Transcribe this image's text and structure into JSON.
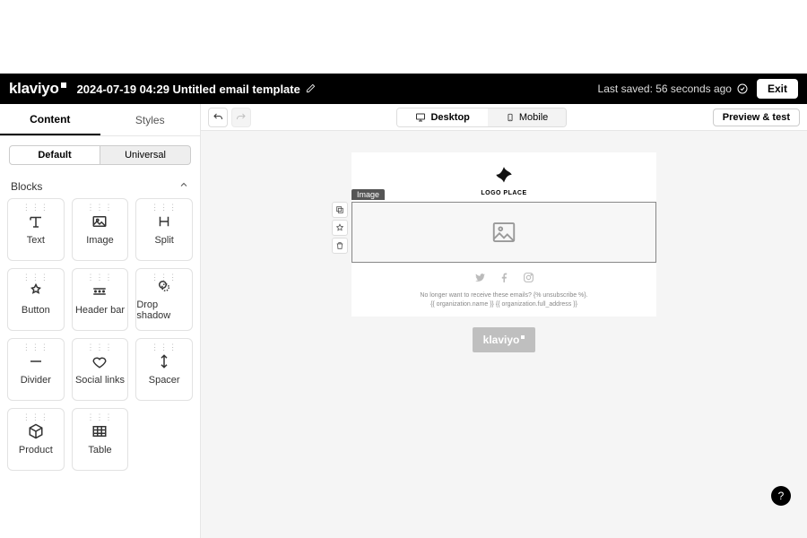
{
  "header": {
    "brand": "klaviyo",
    "title": "2024-07-19 04:29 Untitled email template",
    "last_saved": "Last saved: 56 seconds ago",
    "exit": "Exit"
  },
  "sidebar": {
    "tabs": {
      "content": "Content",
      "styles": "Styles"
    },
    "subtabs": {
      "default": "Default",
      "universal": "Universal"
    },
    "blocks_label": "Blocks",
    "blocks": [
      {
        "id": "text",
        "label": "Text"
      },
      {
        "id": "image",
        "label": "Image"
      },
      {
        "id": "split",
        "label": "Split"
      },
      {
        "id": "button",
        "label": "Button"
      },
      {
        "id": "header-bar",
        "label": "Header bar"
      },
      {
        "id": "drop-shadow",
        "label": "Drop shadow"
      },
      {
        "id": "divider",
        "label": "Divider"
      },
      {
        "id": "social-links",
        "label": "Social links"
      },
      {
        "id": "spacer",
        "label": "Spacer"
      },
      {
        "id": "product",
        "label": "Product"
      },
      {
        "id": "table",
        "label": "Table"
      }
    ]
  },
  "toolbar": {
    "desktop": "Desktop",
    "mobile": "Mobile",
    "preview": "Preview & test"
  },
  "canvas": {
    "logo_caption": "LOGO PLACE",
    "selected_block_tag": "Image",
    "footer_line1": "No longer want to receive these emails? {% unsubscribe %}.",
    "footer_line2": "{{ organization.name }} {{ organization.full_address }}",
    "badge": "klaviyo"
  },
  "help": "?"
}
